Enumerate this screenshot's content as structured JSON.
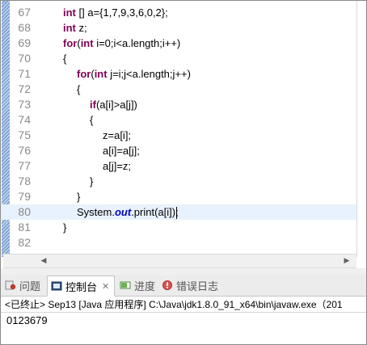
{
  "editor": {
    "lines": [
      {
        "num": "67",
        "segments": [
          {
            "t": "int",
            "kw": true
          },
          {
            "t": " [] a={1,7,9,3,6,0,2};"
          }
        ]
      },
      {
        "num": "68",
        "segments": [
          {
            "t": "int",
            "kw": true
          },
          {
            "t": " z;"
          }
        ]
      },
      {
        "num": "69",
        "segments": [
          {
            "t": "for",
            "kw": true
          },
          {
            "t": "("
          },
          {
            "t": "int",
            "kw": true
          },
          {
            "t": " i=0;i<a.length;i++)"
          }
        ]
      },
      {
        "num": "70",
        "segments": [
          {
            "t": "{"
          }
        ]
      },
      {
        "num": "71",
        "segments": [
          {
            "t": "for",
            "kw": true
          },
          {
            "t": "("
          },
          {
            "t": "int",
            "kw": true
          },
          {
            "t": " j=i;j<a.length;j++)"
          }
        ]
      },
      {
        "num": "72",
        "segments": [
          {
            "t": "{"
          }
        ]
      },
      {
        "num": "73",
        "segments": [
          {
            "t": "if",
            "kw": true
          },
          {
            "t": "(a[i]>a[j])"
          }
        ]
      },
      {
        "num": "74",
        "segments": [
          {
            "t": "{"
          }
        ]
      },
      {
        "num": "75",
        "segments": [
          {
            "t": "z=a[i];"
          }
        ]
      },
      {
        "num": "76",
        "segments": [
          {
            "t": "a[i]=a[j];"
          }
        ]
      },
      {
        "num": "77",
        "segments": [
          {
            "t": "a[j]=z;"
          }
        ]
      },
      {
        "num": "78",
        "segments": [
          {
            "t": "}"
          }
        ]
      },
      {
        "num": "79",
        "segments": [
          {
            "t": "}"
          }
        ]
      },
      {
        "num": "80",
        "segments": [
          {
            "t": "System."
          },
          {
            "t": "out",
            "fld": true
          },
          {
            "t": ".print(a[i]);"
          }
        ]
      },
      {
        "num": "81",
        "segments": [
          {
            "t": "}"
          }
        ]
      },
      {
        "num": "82",
        "segments": []
      }
    ],
    "current_line_index": 13
  },
  "panel": {
    "tabs": [
      {
        "label": "问题",
        "icon": "problems-icon"
      },
      {
        "label": "控制台",
        "icon": "console-icon"
      },
      {
        "label": "进度",
        "icon": "progress-icon"
      },
      {
        "label": "错误日志",
        "icon": "error-log-icon"
      }
    ],
    "active_tab": 1,
    "close_glyph": "✕",
    "console_header": "<已终止> Sep13 [Java 应用程序] C:\\Java\\jdk1.8.0_91_x64\\bin\\javaw.exe（201",
    "console_output": "0123679"
  }
}
